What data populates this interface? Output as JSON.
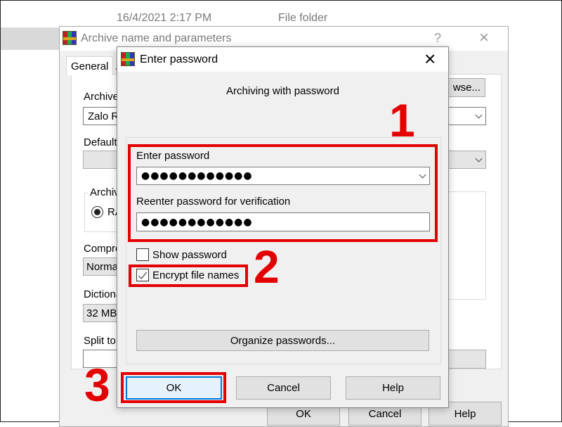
{
  "background": {
    "date": "16/4/2021 2:17 PM",
    "type": "File folder"
  },
  "archive_dialog": {
    "title": "Archive name and parameters",
    "help_glyph": "?",
    "tabs": [
      {
        "label": "General",
        "active": true
      },
      {
        "label": "A"
      }
    ],
    "archive_name_label": "Archive",
    "archive_name_value": "Zalo R",
    "browse_label": "wse...",
    "default_label": "Default",
    "format_group_label": "Archiv",
    "format_radio_label": "RA",
    "compression_label": "Compre",
    "compression_value": "Norma",
    "dictionary_label": "Dictiona",
    "dictionary_value": "32 MB",
    "split_label": "Split to",
    "buttons": {
      "ok": "OK",
      "cancel": "Cancel",
      "help": "Help"
    }
  },
  "password_dialog": {
    "title": "Enter password",
    "heading": "Archiving with password",
    "enter_label": "Enter password",
    "enter_value": "●●●●●●●●●●●●",
    "reenter_label": "Reenter password for verification",
    "reenter_value": "●●●●●●●●●●●●",
    "show_password": {
      "label": "Show password",
      "checked": false
    },
    "encrypt_names": {
      "label": "Encrypt file names",
      "checked": true
    },
    "organize_label": "Organize passwords...",
    "buttons": {
      "ok": "OK",
      "cancel": "Cancel",
      "help": "Help"
    }
  },
  "annotations": {
    "step1": "1",
    "step2": "2",
    "step3": "3",
    "color": "#e30000"
  }
}
